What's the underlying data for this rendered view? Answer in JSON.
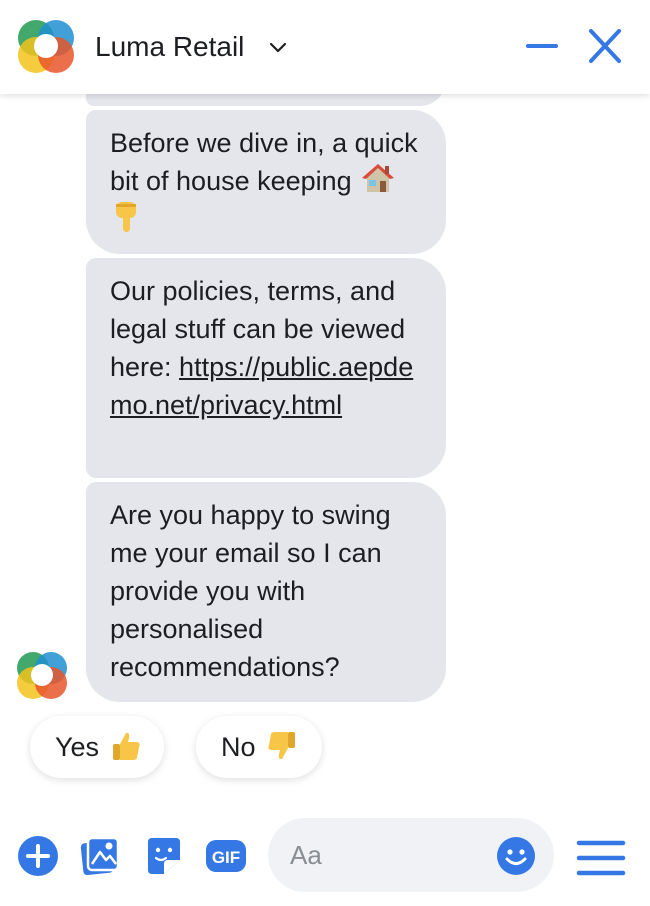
{
  "header": {
    "title": "Luma Retail",
    "title_chevron_icon": "chevron-down-icon",
    "minimize_icon": "minimize-icon",
    "close_icon": "close-icon",
    "accent_color": "#3578e5"
  },
  "messages": [
    {
      "text": "Before we dive in, a quick bit of house keeping",
      "emojis": [
        "house-emoji",
        "pointing-down-emoji"
      ]
    },
    {
      "text": "Our policies, terms, and legal stuff can be viewed here: ",
      "link": "https://public.aepdemo.net/privacy.html"
    },
    {
      "text": "Are you happy to swing me your email so I can provide you with personalised recommendations?"
    }
  ],
  "quick_replies": [
    {
      "label": "Yes",
      "icon": "thumbs-up-emoji"
    },
    {
      "label": "No",
      "icon": "thumbs-down-emoji"
    }
  ],
  "composer": {
    "placeholder": "Aa",
    "tools": [
      "add-icon",
      "photo-icon",
      "sticker-icon",
      "gif-icon"
    ],
    "gif_label": "GIF",
    "emoji_icon": "smiley-icon",
    "menu_icon": "menu-icon"
  },
  "colors": {
    "bubble_bg": "#e4e6eb",
    "accent": "#3578e5",
    "text": "#1c1e21"
  }
}
